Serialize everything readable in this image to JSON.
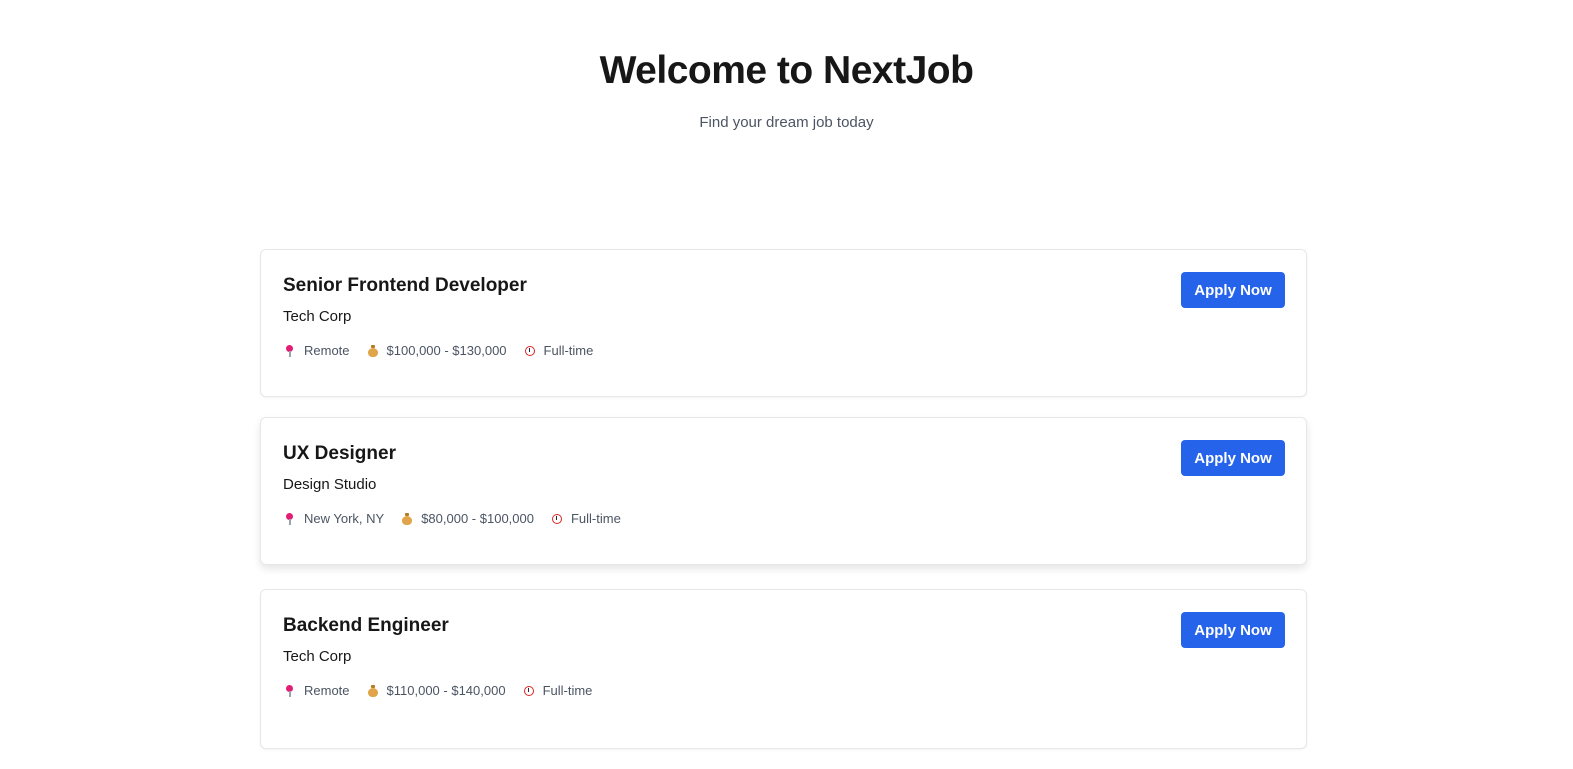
{
  "hero": {
    "title": "Welcome to NextJob",
    "subtitle": "Find your dream job today"
  },
  "jobs": [
    {
      "title": "Senior Frontend Developer",
      "company": "Tech Corp",
      "location": "Remote",
      "salary": "$100,000 - $130,000",
      "type": "Full-time",
      "apply_label": "Apply Now"
    },
    {
      "title": "UX Designer",
      "company": "Design Studio",
      "location": "New York, NY",
      "salary": "$80,000 - $100,000",
      "type": "Full-time",
      "apply_label": "Apply Now"
    },
    {
      "title": "Backend Engineer",
      "company": "Tech Corp",
      "location": "Remote",
      "salary": "$110,000 - $140,000",
      "type": "Full-time",
      "apply_label": "Apply Now"
    }
  ],
  "icons": {
    "location": "pin-icon",
    "salary": "money-bag-icon",
    "type": "alarm-clock-icon"
  },
  "colors": {
    "accent": "#2563eb",
    "text": "#171717",
    "muted": "#4b5563",
    "border": "#e5e7eb"
  }
}
